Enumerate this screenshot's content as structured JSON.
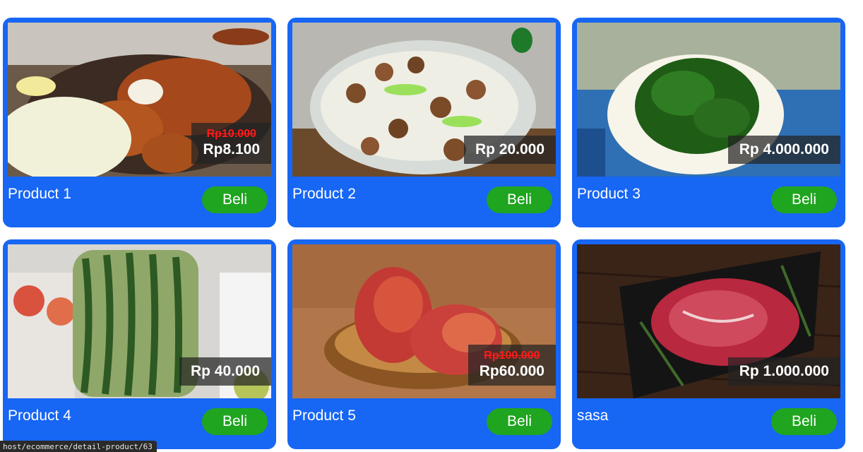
{
  "products": [
    {
      "name": "Product 1",
      "old_price": "Rp10.000",
      "price": "Rp8.100",
      "buy_label": "Beli",
      "image": "fried-cutlet-plate"
    },
    {
      "name": "Product 2",
      "old_price": "",
      "price": "Rp 20.000",
      "buy_label": "Beli",
      "image": "chicken-rice-bowl"
    },
    {
      "name": "Product 3",
      "old_price": "",
      "price": "Rp 4.000.000",
      "buy_label": "Beli",
      "image": "seaweed-bowl"
    },
    {
      "name": "Product 4",
      "old_price": "",
      "price": "Rp 40.000",
      "buy_label": "Beli",
      "image": "square-watermelon"
    },
    {
      "name": "Product 5",
      "old_price": "Rp100.000",
      "price": "Rp60.000",
      "buy_label": "Beli",
      "image": "mango-basket"
    },
    {
      "name": "sasa",
      "old_price": "",
      "price": "Rp 1.000.000",
      "buy_label": "Beli",
      "image": "raw-steak"
    }
  ],
  "status_bar": {
    "url": "host/ecommerce/detail-product/63"
  },
  "colors": {
    "card": "#1766f4",
    "buy_button": "#1fa51f",
    "old_price": "#ff1a1a"
  }
}
